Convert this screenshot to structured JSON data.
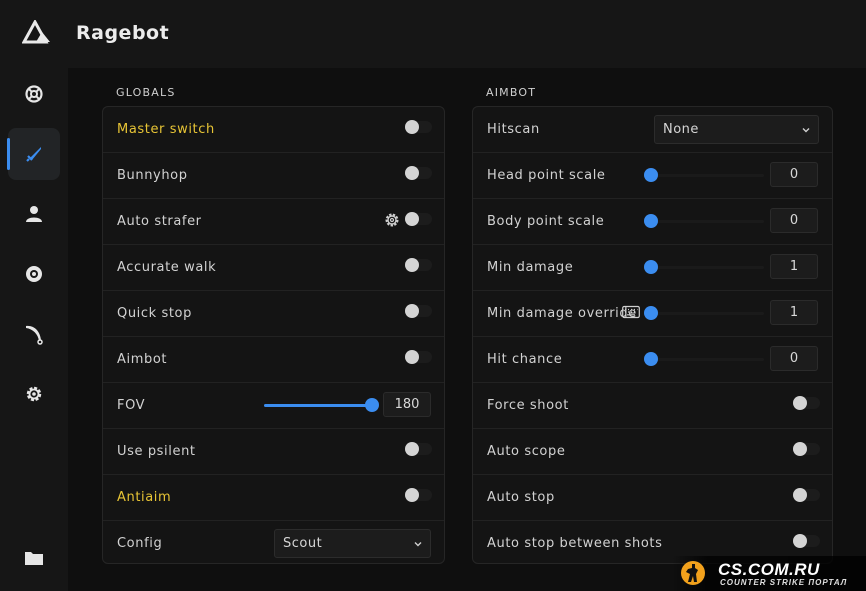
{
  "app": {
    "title": "Ragebot"
  },
  "sidebar": {
    "items": [
      {
        "icon": "lifebuoy-icon",
        "active": false
      },
      {
        "icon": "crosshair-pen-icon",
        "active": true
      },
      {
        "icon": "user-icon",
        "active": false
      },
      {
        "icon": "eye-icon",
        "active": false
      },
      {
        "icon": "knife-icon",
        "active": false
      },
      {
        "icon": "gear-icon",
        "active": false
      },
      {
        "icon": "folder-icon",
        "active": false
      }
    ]
  },
  "globals": {
    "section_title": "GLOBALS",
    "master_switch": {
      "label": "Master switch",
      "on": false
    },
    "bunnyhop": {
      "label": "Bunnyhop",
      "on": false
    },
    "auto_strafer": {
      "label": "Auto strafer",
      "on": false
    },
    "accurate_walk": {
      "label": "Accurate walk",
      "on": false
    },
    "quick_stop": {
      "label": "Quick stop",
      "on": false
    },
    "aimbot": {
      "label": "Aimbot",
      "on": false
    },
    "fov": {
      "label": "FOV",
      "value": "180",
      "level": 1.0
    },
    "use_psilent": {
      "label": "Use psilent",
      "on": false
    },
    "antiaim": {
      "label": "Antiaim",
      "on": false
    },
    "config": {
      "label": "Config",
      "selected": "Scout"
    }
  },
  "aimbot": {
    "section_title": "AIMBOT",
    "hitscan": {
      "label": "Hitscan",
      "selected": "None"
    },
    "head_point_scale": {
      "label": "Head point scale",
      "value": "0",
      "level": 0
    },
    "body_point_scale": {
      "label": "Body point scale",
      "value": "0",
      "level": 0
    },
    "min_damage": {
      "label": "Min damage",
      "value": "1",
      "level": 0
    },
    "min_damage_override": {
      "label": "Min damage override",
      "value": "1",
      "level": 0
    },
    "hit_chance": {
      "label": "Hit chance",
      "value": "0",
      "level": 0
    },
    "force_shoot": {
      "label": "Force shoot",
      "on": false
    },
    "auto_scope": {
      "label": "Auto scope",
      "on": false
    },
    "auto_stop": {
      "label": "Auto stop",
      "on": false
    },
    "auto_stop_between_shots": {
      "label": "Auto stop between shots",
      "on": false
    }
  },
  "colors": {
    "accent": "#3b8df0",
    "highlight_label": "#e7c435",
    "background": "#0f0f0f"
  },
  "watermark": {
    "main": "CS.COM.RU",
    "sub": "COUNTER STRIKE ПОРТАЛ"
  }
}
